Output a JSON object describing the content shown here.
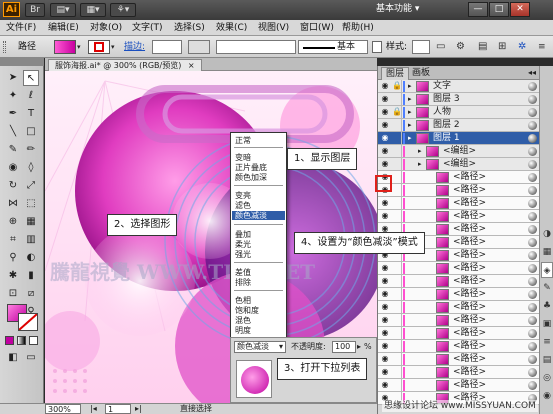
{
  "titlebar": {
    "app_logo": "Ai",
    "buttons": [
      "Br",
      "▤▾",
      "▦▾",
      "⚘▾"
    ],
    "workspace": "基本功能 ▾",
    "window_buttons": [
      "—",
      "□",
      "✕"
    ]
  },
  "menubar": {
    "items": [
      "文件(F)",
      "编辑(E)",
      "对象(O)",
      "文字(T)",
      "选择(S)",
      "效果(C)",
      "视图(V)",
      "窗口(W)",
      "帮助(H)"
    ]
  },
  "controlbar": {
    "object_type": "路径",
    "stroke_label": "描边:",
    "stroke_style": "基本",
    "style_label": "样式:"
  },
  "document": {
    "tab_title": "服饰海报.ai* @ 300% (RGB/预览)",
    "tab_close": "×",
    "watermark": "騰龍視覺 WWW.TLVI.NET"
  },
  "statusbar": {
    "zoom": "300%",
    "page": "1",
    "tool": "直接选择"
  },
  "layers_panel": {
    "tabs": [
      "图层",
      "画板"
    ],
    "rows": [
      {
        "name": "文字",
        "indent": 0,
        "selected": false,
        "path": false,
        "lock": true
      },
      {
        "name": "图层 3",
        "indent": 0,
        "selected": false,
        "path": false,
        "lock": false
      },
      {
        "name": "人物",
        "indent": 0,
        "selected": false,
        "path": false,
        "lock": true
      },
      {
        "name": "图层 2",
        "indent": 0,
        "selected": false,
        "path": false,
        "lock": false
      },
      {
        "name": "图层 1",
        "indent": 0,
        "selected": true,
        "path": false,
        "lock": false
      },
      {
        "name": "<编组>",
        "indent": 1,
        "selected": false,
        "path": false,
        "lock": false
      },
      {
        "name": "<编组>",
        "indent": 1,
        "selected": false,
        "path": false,
        "lock": false
      },
      {
        "name": "<路径>",
        "indent": 2,
        "selected": false,
        "path": true,
        "lock": false
      },
      {
        "name": "<路径>",
        "indent": 2,
        "selected": false,
        "path": true,
        "lock": false
      },
      {
        "name": "<路径>",
        "indent": 2,
        "selected": false,
        "path": true,
        "lock": false
      },
      {
        "name": "<路径>",
        "indent": 2,
        "selected": false,
        "path": true,
        "lock": false
      },
      {
        "name": "<路径>",
        "indent": 2,
        "selected": false,
        "path": true,
        "lock": false
      },
      {
        "name": "<路径>",
        "indent": 2,
        "selected": false,
        "path": true,
        "lock": false
      },
      {
        "name": "<路径>",
        "indent": 2,
        "selected": false,
        "path": true,
        "lock": false
      },
      {
        "name": "<路径>",
        "indent": 2,
        "selected": false,
        "path": true,
        "lock": false
      },
      {
        "name": "<路径>",
        "indent": 2,
        "selected": false,
        "path": true,
        "lock": false
      },
      {
        "name": "<路径>",
        "indent": 2,
        "selected": false,
        "path": true,
        "lock": false
      },
      {
        "name": "<路径>",
        "indent": 2,
        "selected": false,
        "path": true,
        "lock": false
      },
      {
        "name": "<路径>",
        "indent": 2,
        "selected": false,
        "path": true,
        "lock": false
      },
      {
        "name": "<路径>",
        "indent": 2,
        "selected": false,
        "path": true,
        "lock": false
      },
      {
        "name": "<路径>",
        "indent": 2,
        "selected": false,
        "path": true,
        "lock": false
      },
      {
        "name": "<路径>",
        "indent": 2,
        "selected": false,
        "path": true,
        "lock": false
      },
      {
        "name": "<路径>",
        "indent": 2,
        "selected": false,
        "path": true,
        "lock": false
      },
      {
        "name": "<路径>",
        "indent": 2,
        "selected": false,
        "path": true,
        "lock": false
      },
      {
        "name": "<路径>",
        "indent": 2,
        "selected": false,
        "path": true,
        "lock": false
      }
    ]
  },
  "blend_menu": {
    "groups": [
      [
        "正常"
      ],
      [
        "变暗",
        "正片叠底",
        "颜色加深"
      ],
      [
        "变亮",
        "滤色",
        "颜色减淡"
      ],
      [
        "叠加",
        "柔光",
        "强光"
      ],
      [
        "差值",
        "排除"
      ],
      [
        "色相",
        "饱和度",
        "混色",
        "明度"
      ]
    ],
    "highlighted": "颜色减淡"
  },
  "transparency_panel": {
    "mode": "颜色减淡",
    "opacity_label": "不透明度:",
    "opacity_value": "100",
    "opacity_unit": "%"
  },
  "callouts": {
    "step1": "1、显示图层",
    "step2": "2、选择图形",
    "step3": "3、打开下拉列表",
    "step4": "4、设置为“颜色减淡”模式"
  },
  "footer_watermark": "思缘设计论坛 www.MISSYUAN.COM",
  "colors": {
    "accent": "#ff4fd0",
    "selection": "#2f5da8",
    "highlight_box": "#e0201a",
    "fill_swatch": "#e040c8"
  }
}
